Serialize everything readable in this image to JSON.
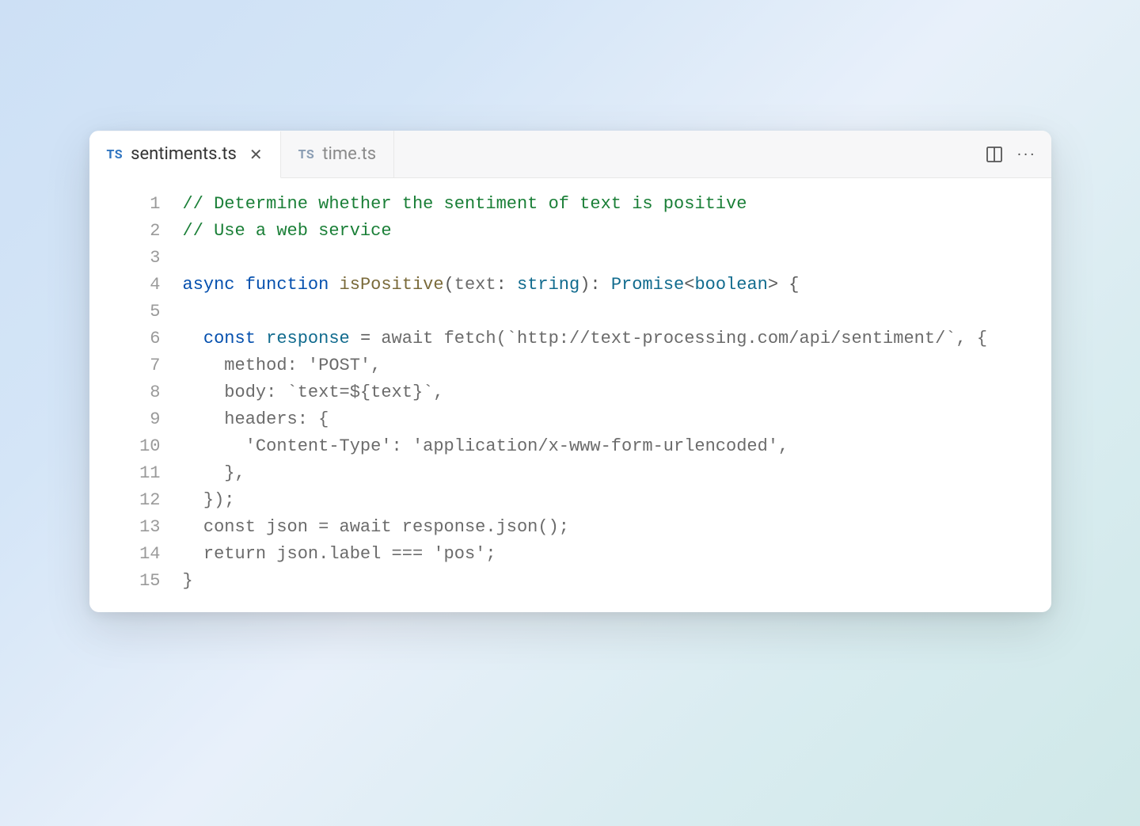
{
  "tabs": {
    "active": {
      "badge": "TS",
      "label": "sentiments.ts"
    },
    "inactive": {
      "badge": "TS",
      "label": "time.ts"
    }
  },
  "lineNumbers": [
    "1",
    "2",
    "3",
    "4",
    "5",
    "6",
    "7",
    "8",
    "9",
    "10",
    "11",
    "12",
    "13",
    "14",
    "15"
  ],
  "code": {
    "l1_comment": "// Determine whether the sentiment of text is positive",
    "l2_comment": "// Use a web service",
    "l4": {
      "kw_async": "async",
      "kw_function": "function",
      "fn_name": "isPositive",
      "open_paren": "(",
      "param": "text",
      "colon_sp": ": ",
      "param_type": "string",
      "close_paren_colon": "): ",
      "ret_type1": "Promise",
      "lt": "<",
      "ret_type2": "boolean",
      "gt_brace": "> {"
    },
    "l6": {
      "indent": "  ",
      "kw_const": "const",
      "sp1": " ",
      "var": "response",
      "sp2": " ",
      "eq": "=",
      "rest": " await fetch(`http://text-processing.com/api/sentiment/`, {"
    },
    "l7": "    method: 'POST',",
    "l8": "    body: `text=${text}`,",
    "l9": "    headers: {",
    "l10": "      'Content-Type': 'application/x-www-form-urlencoded',",
    "l11": "    },",
    "l12": "  });",
    "l13": "  const json = await response.json();",
    "l14": "  return json.label === 'pos';",
    "l15": "}"
  }
}
